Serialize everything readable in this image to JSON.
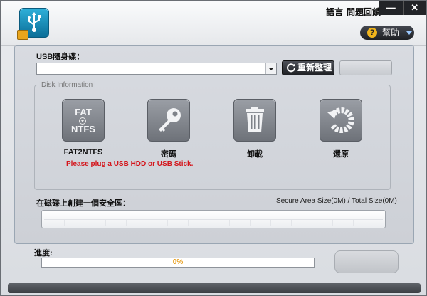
{
  "titlebar": {
    "language_label": "語言",
    "feedback_label": "問題回饋",
    "minimize_glyph": "—",
    "close_glyph": "✕"
  },
  "help": {
    "label": "幫助",
    "icon_glyph": "?"
  },
  "usb": {
    "label": "USB隨身碟：",
    "selected_value": "",
    "refresh_label": "重新整理"
  },
  "disk_info": {
    "legend": "Disk Information",
    "tiles": [
      {
        "label": "FAT2NTFS",
        "icon": "fat-ntfs-icon",
        "line1": "FAT",
        "line2": "NTFS"
      },
      {
        "label": "密碼",
        "icon": "key-icon"
      },
      {
        "label": "卸載",
        "icon": "trash-icon"
      },
      {
        "label": "還原",
        "icon": "restore-icon"
      }
    ],
    "warning": "Please plug a USB HDD or USB Stick."
  },
  "secure_area": {
    "label": "在磁碟上創建一個安全區：",
    "size_text": "Secure Area Size(0M) / Total Size(0M)"
  },
  "progress": {
    "label": "進度:",
    "text": "0%",
    "value": 0
  },
  "colors": {
    "warning": "#d4141a",
    "progress_text": "#e8a020",
    "accent_icon": "#0b6e98"
  }
}
